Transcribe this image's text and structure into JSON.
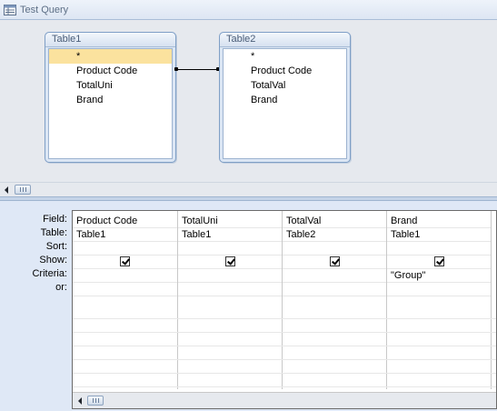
{
  "window": {
    "title": "Test Query"
  },
  "tables": [
    {
      "name": "Table1",
      "fields": [
        "*",
        "Product Code",
        "TotalUni",
        "Brand"
      ],
      "selected_index": 0
    },
    {
      "name": "Table2",
      "fields": [
        "*",
        "Product Code",
        "TotalVal",
        "Brand"
      ]
    }
  ],
  "grid": {
    "row_labels": [
      "Field:",
      "Table:",
      "Sort:",
      "Show:",
      "Criteria:",
      "or:"
    ],
    "columns": [
      {
        "field": "Product Code",
        "table": "Table1",
        "sort": "",
        "show": true,
        "criteria": "",
        "or": ""
      },
      {
        "field": "TotalUni",
        "table": "Table1",
        "sort": "",
        "show": true,
        "criteria": "",
        "or": ""
      },
      {
        "field": "TotalVal",
        "table": "Table2",
        "sort": "",
        "show": true,
        "criteria": "",
        "or": ""
      },
      {
        "field": "Brand",
        "table": "Table1",
        "sort": "",
        "show": true,
        "criteria": "\"Group\"",
        "or": ""
      }
    ]
  },
  "colors": {
    "selected_field": "#fbe29e",
    "table_border": "#7f9fc6",
    "background": "#dfe8f6"
  }
}
